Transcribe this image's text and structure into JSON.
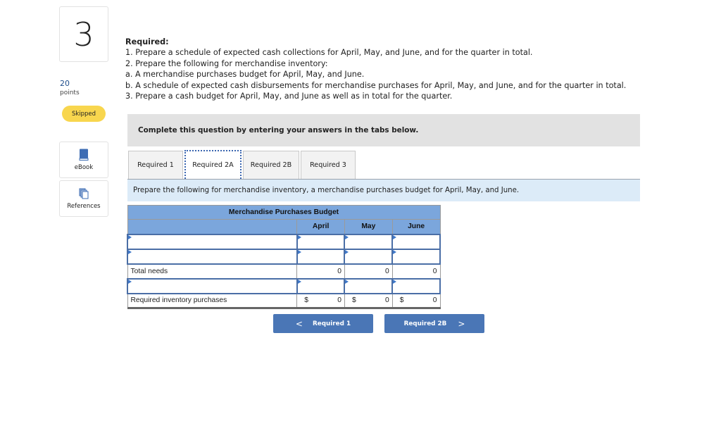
{
  "question": {
    "number": "3",
    "points_value": "20",
    "points_label": "points",
    "status_badge": "Skipped"
  },
  "sidebar": {
    "ebook_label": "eBook",
    "references_label": "References"
  },
  "required": {
    "header": "Required:",
    "lines": [
      "1. Prepare a schedule of expected cash collections for April, May, and June, and for the quarter in total.",
      "2. Prepare the following for merchandise inventory:",
      "a. A merchandise purchases budget for April, May, and June.",
      "b. A schedule of expected cash disbursements for merchandise purchases for April, May, and June, and for the quarter in total.",
      "3. Prepare a cash budget for April, May, and June as well as in total for the quarter."
    ]
  },
  "banner": "Complete this question by entering your answers in the tabs below.",
  "tabs": [
    {
      "label": "Required 1",
      "active": false
    },
    {
      "label": "Required 2A",
      "active": true
    },
    {
      "label": "Required 2B",
      "active": false
    },
    {
      "label": "Required 3",
      "active": false
    }
  ],
  "tab_instruction": "Prepare the following for merchandise inventory, a merchandise purchases budget for April, May, and June.",
  "table": {
    "title": "Merchandise Purchases Budget",
    "columns": [
      "April",
      "May",
      "June"
    ],
    "rows": [
      {
        "type": "input",
        "label": "",
        "values": [
          "",
          "",
          ""
        ]
      },
      {
        "type": "input",
        "label": "",
        "values": [
          "",
          "",
          ""
        ]
      },
      {
        "type": "computed",
        "label": "Total needs",
        "values": [
          "0",
          "0",
          "0"
        ]
      },
      {
        "type": "input",
        "label": "",
        "values": [
          "",
          "",
          ""
        ]
      },
      {
        "type": "final",
        "label": "Required inventory purchases",
        "currency": "$",
        "values": [
          "0",
          "0",
          "0"
        ]
      }
    ]
  },
  "nav": {
    "prev_label": "Required 1",
    "next_label": "Required 2B",
    "prev_icon": "chevron-left-icon",
    "next_icon": "chevron-right-icon"
  },
  "colors": {
    "table_header": "#7ba6dc",
    "nav_button": "#4a76b6",
    "skipped_badge": "#f8d64e",
    "instruction_bg": "#dcebf8",
    "points_text": "#1f4e8c"
  }
}
